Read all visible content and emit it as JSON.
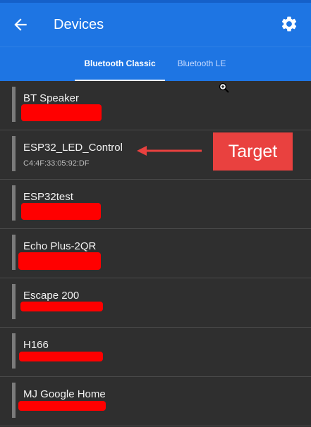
{
  "appbar": {
    "title": "Devices",
    "back_icon": "arrow-back-icon",
    "settings_icon": "gear-icon"
  },
  "tabs": [
    {
      "label": "Bluetooth Classic",
      "selected": true
    },
    {
      "label": "Bluetooth LE",
      "selected": false
    }
  ],
  "devices": [
    {
      "name": "BT Speaker",
      "address": null
    },
    {
      "name": "ESP32_LED_Control",
      "address": "C4:4F:33:05:92:DF"
    },
    {
      "name": "ESP32test",
      "address": null
    },
    {
      "name": "Echo Plus-2QR",
      "address": null
    },
    {
      "name": "Escape 200",
      "address": null
    },
    {
      "name": "H166",
      "address": null
    },
    {
      "name": "MJ Google Home",
      "address": null
    }
  ],
  "annotation": {
    "label": "Target",
    "color": "#e9413f"
  },
  "colors": {
    "appbar": "#1e75e3",
    "background": "#2f2f2f",
    "redaction": "#ff0000"
  }
}
